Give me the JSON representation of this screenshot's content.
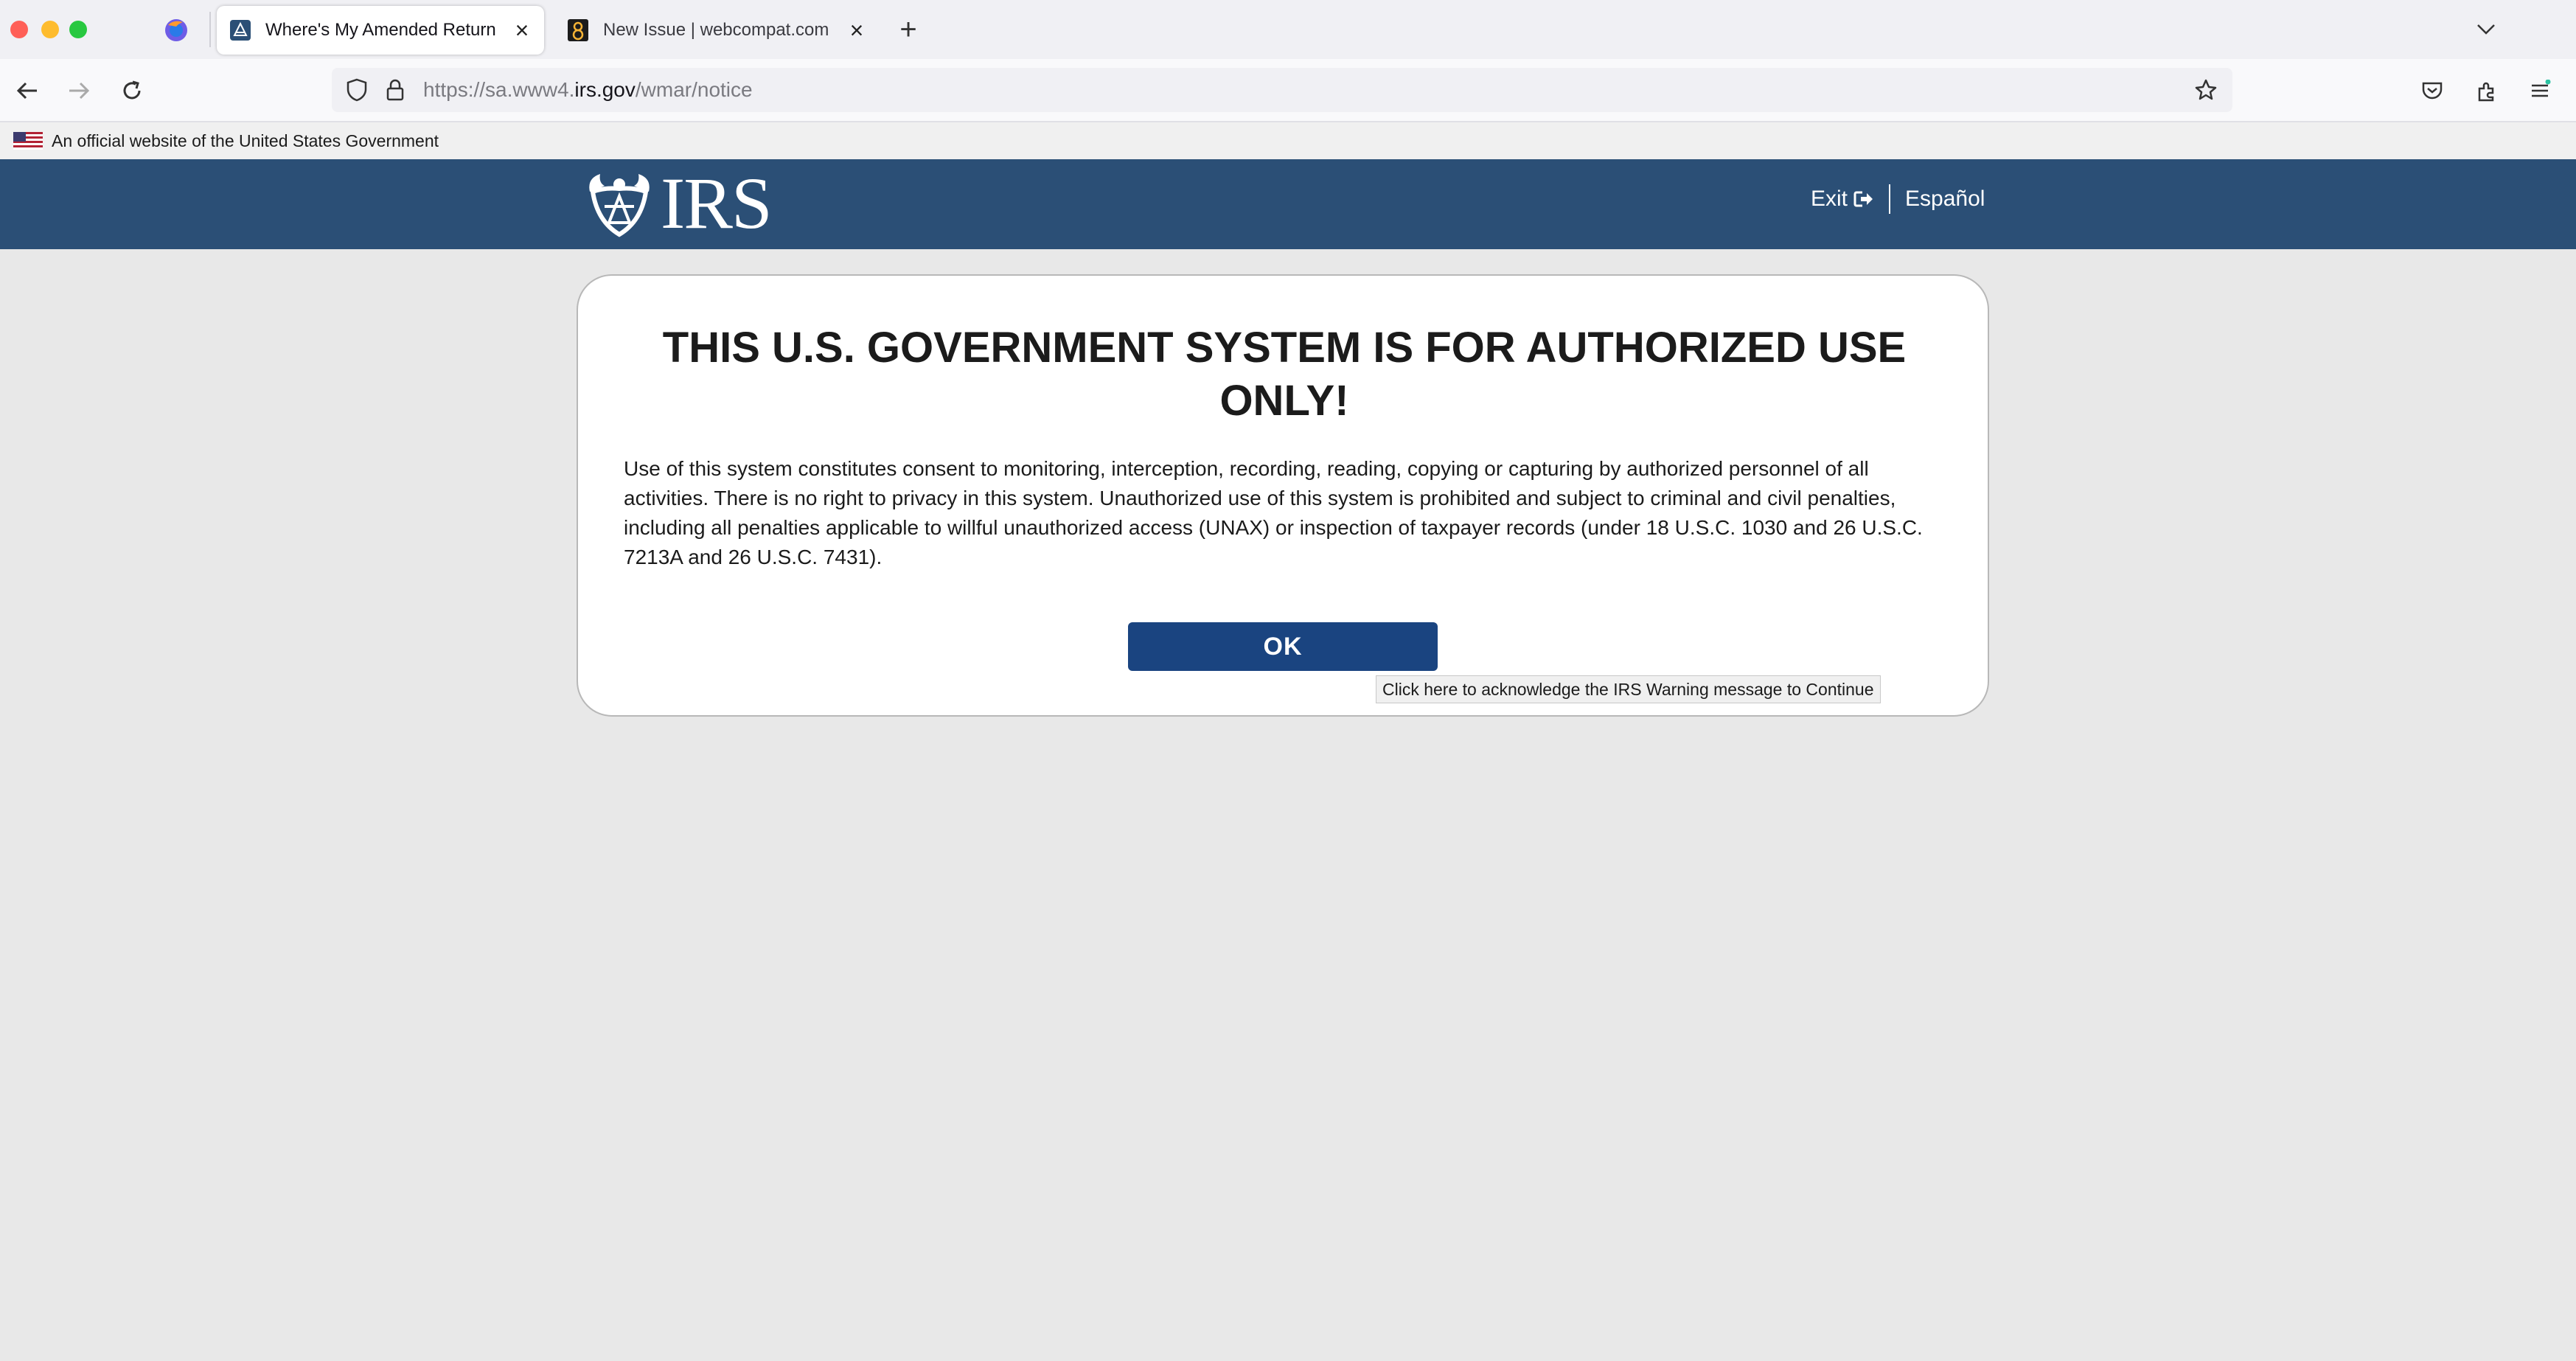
{
  "browser": {
    "tabs": [
      {
        "title": "Where's My Amended Return",
        "active": true,
        "favicon": "irs-seal-icon"
      },
      {
        "title": "New Issue | webcompat.com",
        "active": false,
        "favicon": "webcompat-icon"
      }
    ],
    "url": {
      "prefix": "https://sa.www4.",
      "domain": "irs.gov",
      "path": "/wmar/notice"
    }
  },
  "gov_banner": {
    "text": "An official website of the United States Government"
  },
  "header": {
    "logo_text": "IRS",
    "exit_label": "Exit",
    "espanol_label": "Español",
    "bg_color": "#2b4f76"
  },
  "notice": {
    "title": "THIS U.S. GOVERNMENT SYSTEM IS FOR AUTHORIZED USE ONLY!",
    "body": "Use of this system constitutes consent to monitoring, interception, recording, reading, copying or capturing by authorized personnel of all activities. There is no right to privacy in this system. Unauthorized use of this system is prohibited and subject to criminal and civil penalties, including all penalties applicable to willful unauthorized access (UNAX) or inspection of taxpayer records (under 18 U.S.C. 1030 and 26 U.S.C. 7213A and 26 U.S.C. 7431).",
    "ok_label": "OK",
    "ok_color": "#1a4480",
    "tooltip": "Click here to acknowledge the IRS Warning message to Continue"
  }
}
